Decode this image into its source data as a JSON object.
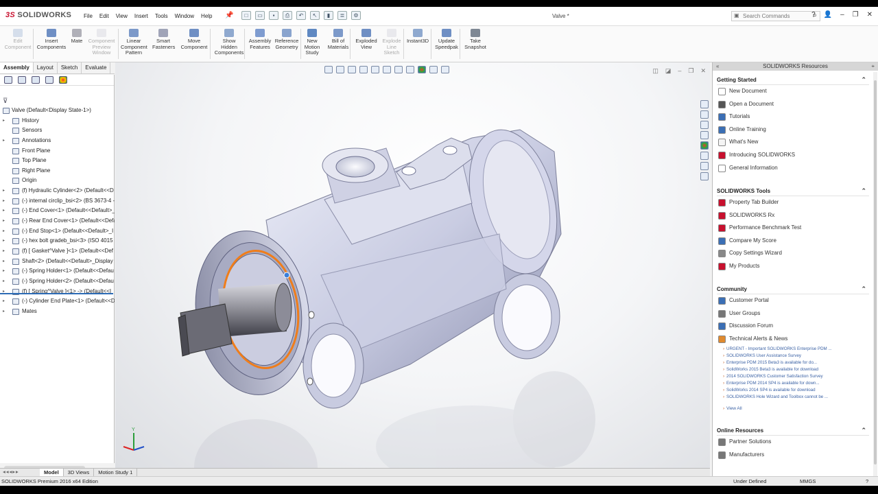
{
  "app": {
    "brand": "SOLIDWORKS",
    "doc_title": "Valve *"
  },
  "menu": [
    "File",
    "Edit",
    "View",
    "Insert",
    "Tools",
    "Window",
    "Help"
  ],
  "search": {
    "placeholder": "Search Commands"
  },
  "ribbon": [
    {
      "label": "Edit Component",
      "disabled": true
    },
    {
      "label": "Insert Components",
      "disabled": false
    },
    {
      "label": "Mate",
      "disabled": false
    },
    {
      "label": "Component Preview Window",
      "disabled": true
    },
    {
      "label": "Linear Component Pattern",
      "disabled": false
    },
    {
      "label": "Smart Fasteners",
      "disabled": false
    },
    {
      "label": "Move Component",
      "disabled": false
    },
    {
      "label": "Show Hidden Components",
      "disabled": false
    },
    {
      "label": "Assembly Features",
      "disabled": false
    },
    {
      "label": "Reference Geometry",
      "disabled": false
    },
    {
      "label": "New Motion Study",
      "disabled": false
    },
    {
      "label": "Bill of Materials",
      "disabled": false
    },
    {
      "label": "Exploded View",
      "disabled": false
    },
    {
      "label": "Explode Line Sketch",
      "disabled": true
    },
    {
      "label": "Instant3D",
      "disabled": false
    },
    {
      "label": "Update Speedpak",
      "disabled": false
    },
    {
      "label": "Take Snapshot",
      "disabled": false
    }
  ],
  "cm_tabs": [
    "Assembly",
    "Layout",
    "Sketch",
    "Evaluate"
  ],
  "tree": {
    "root": "Valve  (Default<Display State-1>)",
    "items": [
      "History",
      "Sensors",
      "Annotations",
      "Front Plane",
      "Top Plane",
      "Right Plane",
      "Origin",
      "(f) Hydraulic Cylinder<2> (Default<<D",
      "(-) internal circlip_bsi<2> (BS 3673-4 -",
      "(-) End Cover<1> (Default<<Default>_",
      "(-) Rear End Cover<1> (Default<<Defa",
      "(-) End Stop<1> (Default<<Default>_I",
      "(-) hex bolt gradeb_bsi<3> (ISO 4015 -",
      "(f) [ Gasket^Valve ]<1> (Default<<Def",
      "Shaft<2> (Default<<Default>_Display",
      "(-) Spring Holder<1> (Default<<Defau",
      "(-) Spring Holder<2> (Default<<Defau",
      "(f) [ Spring^Valve ]<1> -> (Default<<I",
      "(-) Cylinder End Plate<1> (Default<<D",
      "Mates"
    ]
  },
  "resources": {
    "title": "SOLIDWORKS Resources",
    "getting_started": {
      "title": "Getting Started",
      "items": [
        "New Document",
        "Open a Document",
        "Tutorials",
        "Online Training",
        "What's New",
        "Introducing SOLIDWORKS",
        "General Information"
      ]
    },
    "tools": {
      "title": "SOLIDWORKS Tools",
      "items": [
        "Property Tab Builder",
        "SOLIDWORKS Rx",
        "Performance Benchmark Test",
        "Compare My Score",
        "Copy Settings Wizard",
        "My Products"
      ]
    },
    "community": {
      "title": "Community",
      "items": [
        "Customer Portal",
        "User Groups",
        "Discussion Forum",
        "Technical Alerts & News"
      ]
    },
    "news": [
      "URGENT - Important SOLIDWORKS Enterprise PDM ...",
      "SOLIDWORKS User Assistance Survey",
      "Enterprise PDM 2015 Beta3 is available for do...",
      "SolidWorks 2015 Beta3 is available for download",
      "2014 SOLIDWORKS Customer Satisfaction Survey",
      "Enterprise PDM 2014 SP4 is available for down...",
      "SolidWorks 2014 SP4 is available for download",
      "SOLIDWORKS Hole Wizard and Toolbox cannot be ..."
    ],
    "view_all": "View All",
    "online": {
      "title": "Online Resources",
      "items": [
        "Partner Solutions",
        "Manufacturers"
      ]
    }
  },
  "bottom_tabs": [
    "Model",
    "3D Views",
    "Motion Study 1"
  ],
  "status": {
    "left": "SOLIDWORKS Premium 2016 x64 Edition",
    "state": "Under Defined",
    "units": "MMGS",
    "help": "?"
  },
  "colors": {
    "brand": "#c8102e",
    "highlight": "#f07d1a",
    "part": "#d9dbee",
    "link": "#3b62a5"
  }
}
